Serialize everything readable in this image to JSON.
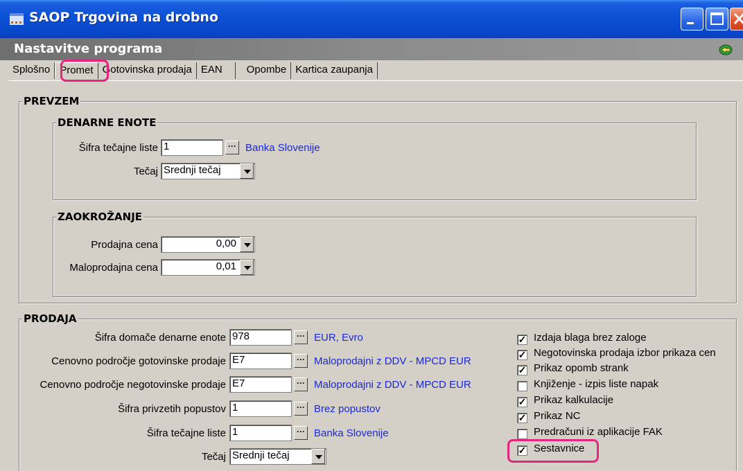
{
  "window": {
    "title": "SAOP Trgovina na drobno",
    "subtitle": "Nastavitve programa"
  },
  "tabs": [
    {
      "label": "Splošno"
    },
    {
      "label": "Promet",
      "active": true
    },
    {
      "label": "Gotovinska prodaja"
    },
    {
      "label": "EAN"
    },
    {
      "label": "Opombe"
    },
    {
      "label": "Kartica zaupanja"
    }
  ],
  "prevzem": {
    "legend": "PREVZEM",
    "denarne_enote": {
      "legend": "DENARNE ENOTE",
      "sifra_label": "Šifra tečajne liste",
      "sifra_value": "1",
      "sifra_desc": "Banka Slovenije",
      "tecaj_label": "Tečaj",
      "tecaj_value": "Srednji tečaj"
    },
    "zaokrozanje": {
      "legend": "ZAOKROŽANJE",
      "prodajna_label": "Prodajna cena",
      "prodajna_value": "0,00",
      "maloprodajna_label": "Maloprodajna cena",
      "maloprodajna_value": "0,01"
    }
  },
  "prodaja": {
    "legend": "PRODAJA",
    "rows": [
      {
        "label": "Šifra domače denarne enote",
        "value": "978",
        "desc": "EUR, Evro"
      },
      {
        "label": "Cenovno področje gotovinske prodaje",
        "value": "E7",
        "desc": "Maloprodajni z DDV - MPCD EUR"
      },
      {
        "label": "Cenovno področje negotovinske prodaje",
        "value": "E7",
        "desc": "Maloprodajni z DDV - MPCD EUR"
      },
      {
        "label": "Šifra privzetih popustov",
        "value": "1",
        "desc": "Brez popustov"
      },
      {
        "label": "Šifra tečajne liste",
        "value": "1",
        "desc": "Banka Slovenije"
      }
    ],
    "tecaj_label": "Tečaj",
    "tecaj_value": "Srednji tečaj",
    "checkboxes": [
      {
        "label": "Izdaja blaga brez zaloge",
        "checked": true
      },
      {
        "label": "Negotovinska prodaja izbor prikaza cen",
        "checked": true
      },
      {
        "label": "Prikaz opomb strank",
        "checked": true
      },
      {
        "label": "Knjiženje - izpis liste napak",
        "checked": false
      },
      {
        "label": "Prikaz kalkulacije",
        "checked": true
      },
      {
        "label": "Prikaz NC",
        "checked": true
      },
      {
        "label": "Predračuni iz aplikacije FAK",
        "checked": false
      },
      {
        "label": "Sestavnice",
        "checked": true
      }
    ]
  },
  "colors": {
    "highlight": "#e5267f",
    "link_blue": "#1a28d8"
  }
}
